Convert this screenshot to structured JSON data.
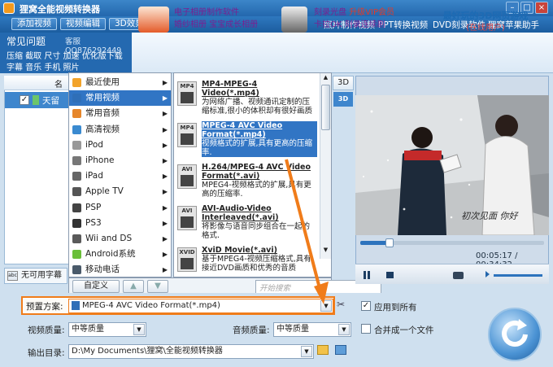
{
  "app": {
    "title": "狸窝全能视频转换器"
  },
  "menubar": {
    "buttons": [
      "添加视频",
      "视频编辑",
      "3D效果"
    ],
    "links": [
      "照片制作视频",
      "PPT转换视频",
      "DVD刻录软件",
      "狸窝苹果助手"
    ]
  },
  "faq": {
    "title": "常见问题",
    "qq": "客服QQ876292449",
    "rows": [
      "压缩 截取 尺寸 加速 优化版下载",
      "字幕 音乐 手机 照片"
    ]
  },
  "toolbar": {
    "group1": [
      "电子相册制作软件",
      "婚纱相册 宝宝成长相册"
    ],
    "group2_line1": "刻录光盘",
    "group2_vip": "升级VIP会员",
    "group2_line2": "卡拉OK 刻录连续剧",
    "promo_title": "最好玩的3D网页游戏",
    "promo_sub": "(在线用户)"
  },
  "list": {
    "header": "名称",
    "row1": "天留",
    "subtitle": "无可用字幕"
  },
  "menu1": {
    "items": [
      "最近使用",
      "常用视频",
      "常用音频",
      "高清视频",
      "iPod",
      "iPhone",
      "iPad",
      "Apple TV",
      "PSP",
      "PS3",
      "Wii and DS",
      "Android系统",
      "移动电话"
    ],
    "selected_index": 1
  },
  "menu2": {
    "items": [
      {
        "tag": "MP4",
        "title": "MP4-MPEG-4 Video(*.mp4)",
        "desc": "为网络广播、视频通讯定制的压缩标准,很小的体积却有很好画质"
      },
      {
        "tag": "MP4",
        "title": "MPEG-4 AVC Video Format(*.mp4)",
        "desc": "视频格式的扩展,具有更高的压缩率."
      },
      {
        "tag": "AVI",
        "title": "H.264/MPEG-4 AVC Video Format(*.avi)",
        "desc": "MPEG4-视频格式的扩展,具有更高的压缩率."
      },
      {
        "tag": "AVI",
        "title": "AVI-Audio-Video Interleaved(*.avi)",
        "desc": "将影像与语音同步组合在一起的格式."
      },
      {
        "tag": "XVID",
        "title": "XviD Movie(*.avi)",
        "desc": "基于MPEG4-视频压缩格式,具有接近DVD画质和优秀的音质"
      }
    ],
    "selected_index": 1
  },
  "menu_bottom": {
    "custom_label": "自定义",
    "search_placeholder": "开始搜索"
  },
  "player": {
    "header_3d": "3D",
    "current_time": "00:05:17",
    "total_time": "00:34:32",
    "progress": 0.15,
    "caption": "初次见面 你好"
  },
  "settings": {
    "preset_label": "预置方案:",
    "preset_value": "MPEG-4 AVC Video Format(*.mp4)",
    "apply_all_label": "应用到所有",
    "apply_all_checked": true,
    "video_quality_label": "视频质量:",
    "video_quality_value": "中等质量",
    "audio_quality_label": "音频质量:",
    "audio_quality_value": "中等质量",
    "merge_label": "合并成一个文件",
    "merge_checked": false,
    "output_label": "输出目录:",
    "output_value": "D:\\My Documents\\狸窝\\全能视频转换器"
  },
  "colors": {
    "accent": "#3175c4",
    "highlight": "#f07c1a"
  }
}
